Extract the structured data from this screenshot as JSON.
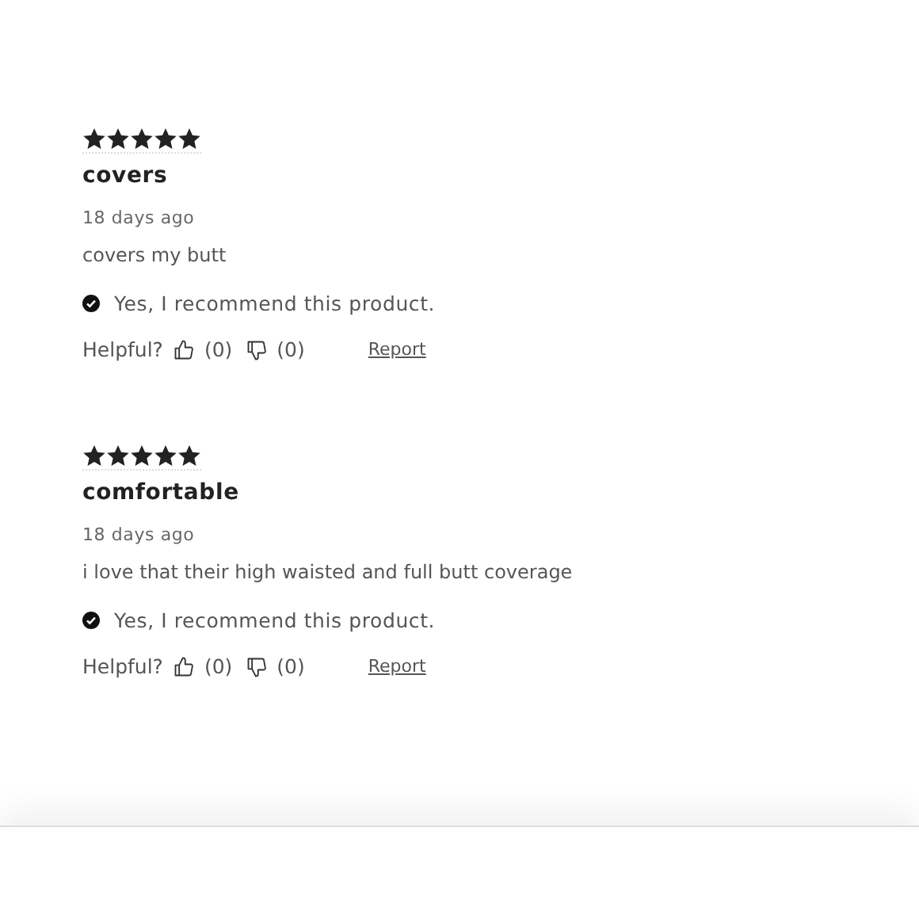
{
  "reviews": [
    {
      "stars": 5,
      "title": "covers",
      "date": "18 days ago",
      "body": "covers my butt",
      "recommended": true,
      "recommend_text": "Yes, I recommend this product.",
      "helpful_label": "Helpful?",
      "up_count": "(0)",
      "down_count": "(0)",
      "report": "Report"
    },
    {
      "stars": 5,
      "title": "comfortable",
      "date": "18 days ago",
      "body": "i love that their high waisted and full butt coverage",
      "recommended": true,
      "recommend_text": "Yes, I recommend this product.",
      "helpful_label": "Helpful?",
      "up_count": "(0)",
      "down_count": "(0)",
      "report": "Report"
    }
  ]
}
